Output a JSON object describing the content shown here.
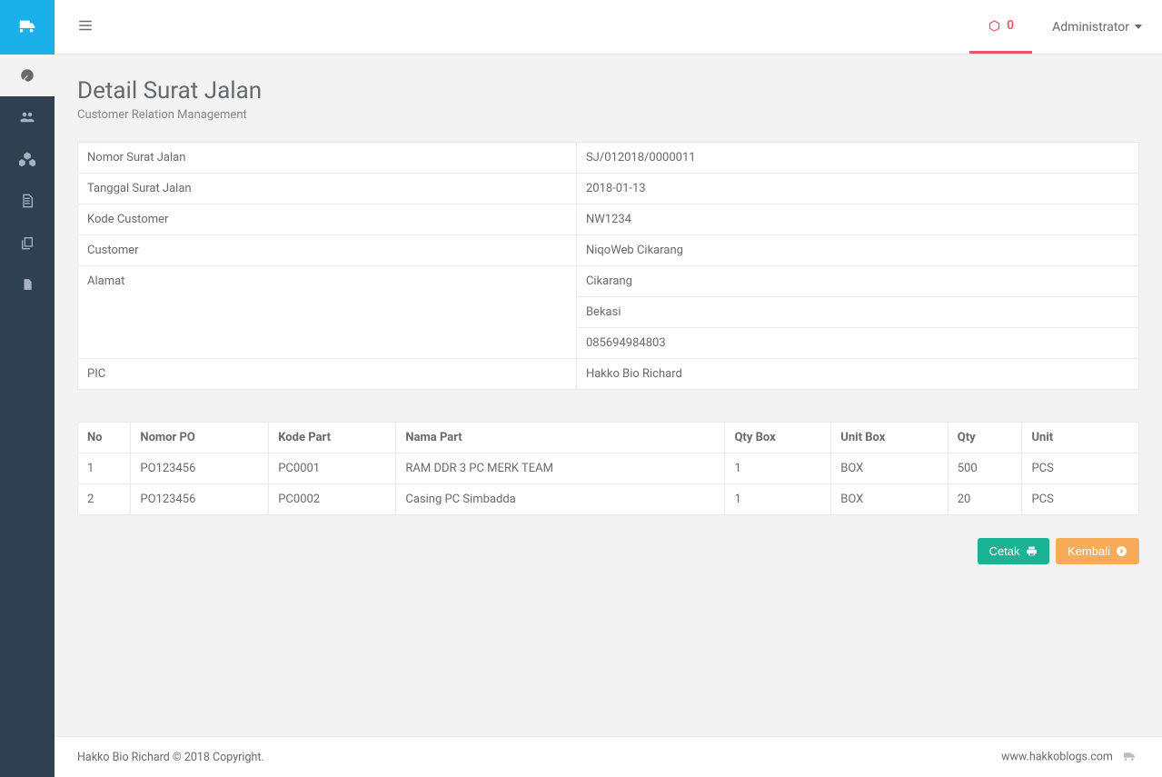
{
  "topbar": {
    "box_count": "0",
    "admin_label": "Administrator"
  },
  "page": {
    "title": "Detail Surat Jalan",
    "subtitle": "Customer Relation Management"
  },
  "detail": {
    "labels": {
      "nomor": "Nomor Surat Jalan",
      "tanggal": "Tanggal Surat Jalan",
      "kode_customer": "Kode Customer",
      "customer": "Customer",
      "alamat": "Alamat",
      "pic": "PIC"
    },
    "values": {
      "nomor": "SJ/012018/0000011",
      "tanggal": "2018-01-13",
      "kode_customer": "NW1234",
      "customer": "NiqoWeb Cikarang",
      "alamat1": "Cikarang",
      "alamat2": "Bekasi",
      "alamat3": "085694984803",
      "pic": "Hakko Bio Richard"
    }
  },
  "items_table": {
    "headers": {
      "no": "No",
      "nomor_po": "Nomor PO",
      "kode_part": "Kode Part",
      "nama_part": "Nama Part",
      "qty_box": "Qty Box",
      "unit_box": "Unit Box",
      "qty": "Qty",
      "unit": "Unit"
    },
    "rows": [
      {
        "no": "1",
        "nomor_po": "PO123456",
        "kode_part": "PC0001",
        "nama_part": "RAM DDR 3 PC MERK TEAM",
        "qty_box": "1",
        "unit_box": "BOX",
        "qty": "500",
        "unit": "PCS"
      },
      {
        "no": "2",
        "nomor_po": "PO123456",
        "kode_part": "PC0002",
        "nama_part": "Casing PC Simbadda",
        "qty_box": "1",
        "unit_box": "BOX",
        "qty": "20",
        "unit": "PCS"
      }
    ]
  },
  "buttons": {
    "cetak": "Cetak",
    "kembali": "Kembali"
  },
  "footer": {
    "copyright": "Hakko Bio Richard © 2018 Copyright.",
    "site": "www.hakkoblogs.com"
  }
}
